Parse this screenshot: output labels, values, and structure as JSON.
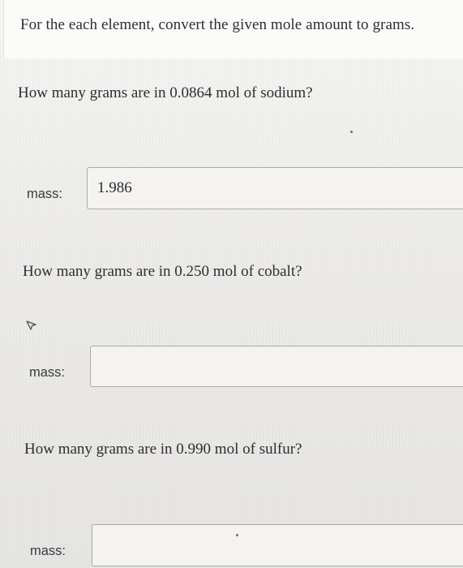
{
  "instructions": "For the each element, convert the given mole amount to grams.",
  "questions": [
    {
      "prompt": "How many grams are in 0.0864 mol of sodium?",
      "input_label": "mass:",
      "input_value": "1.986"
    },
    {
      "prompt": "How many grams are in 0.250 mol of cobalt?",
      "input_label": "mass:",
      "input_value": ""
    },
    {
      "prompt": "How many grams are in 0.990 mol of sulfur?",
      "input_label": "mass:",
      "input_value": ""
    }
  ],
  "icons": {
    "pointer": "mouse-pointer-icon"
  },
  "colors": {
    "background": "#ecebe9",
    "instructions_background": "#fbfbfa",
    "text": "#2e2e2e",
    "input_border": "#a9a9a7"
  }
}
